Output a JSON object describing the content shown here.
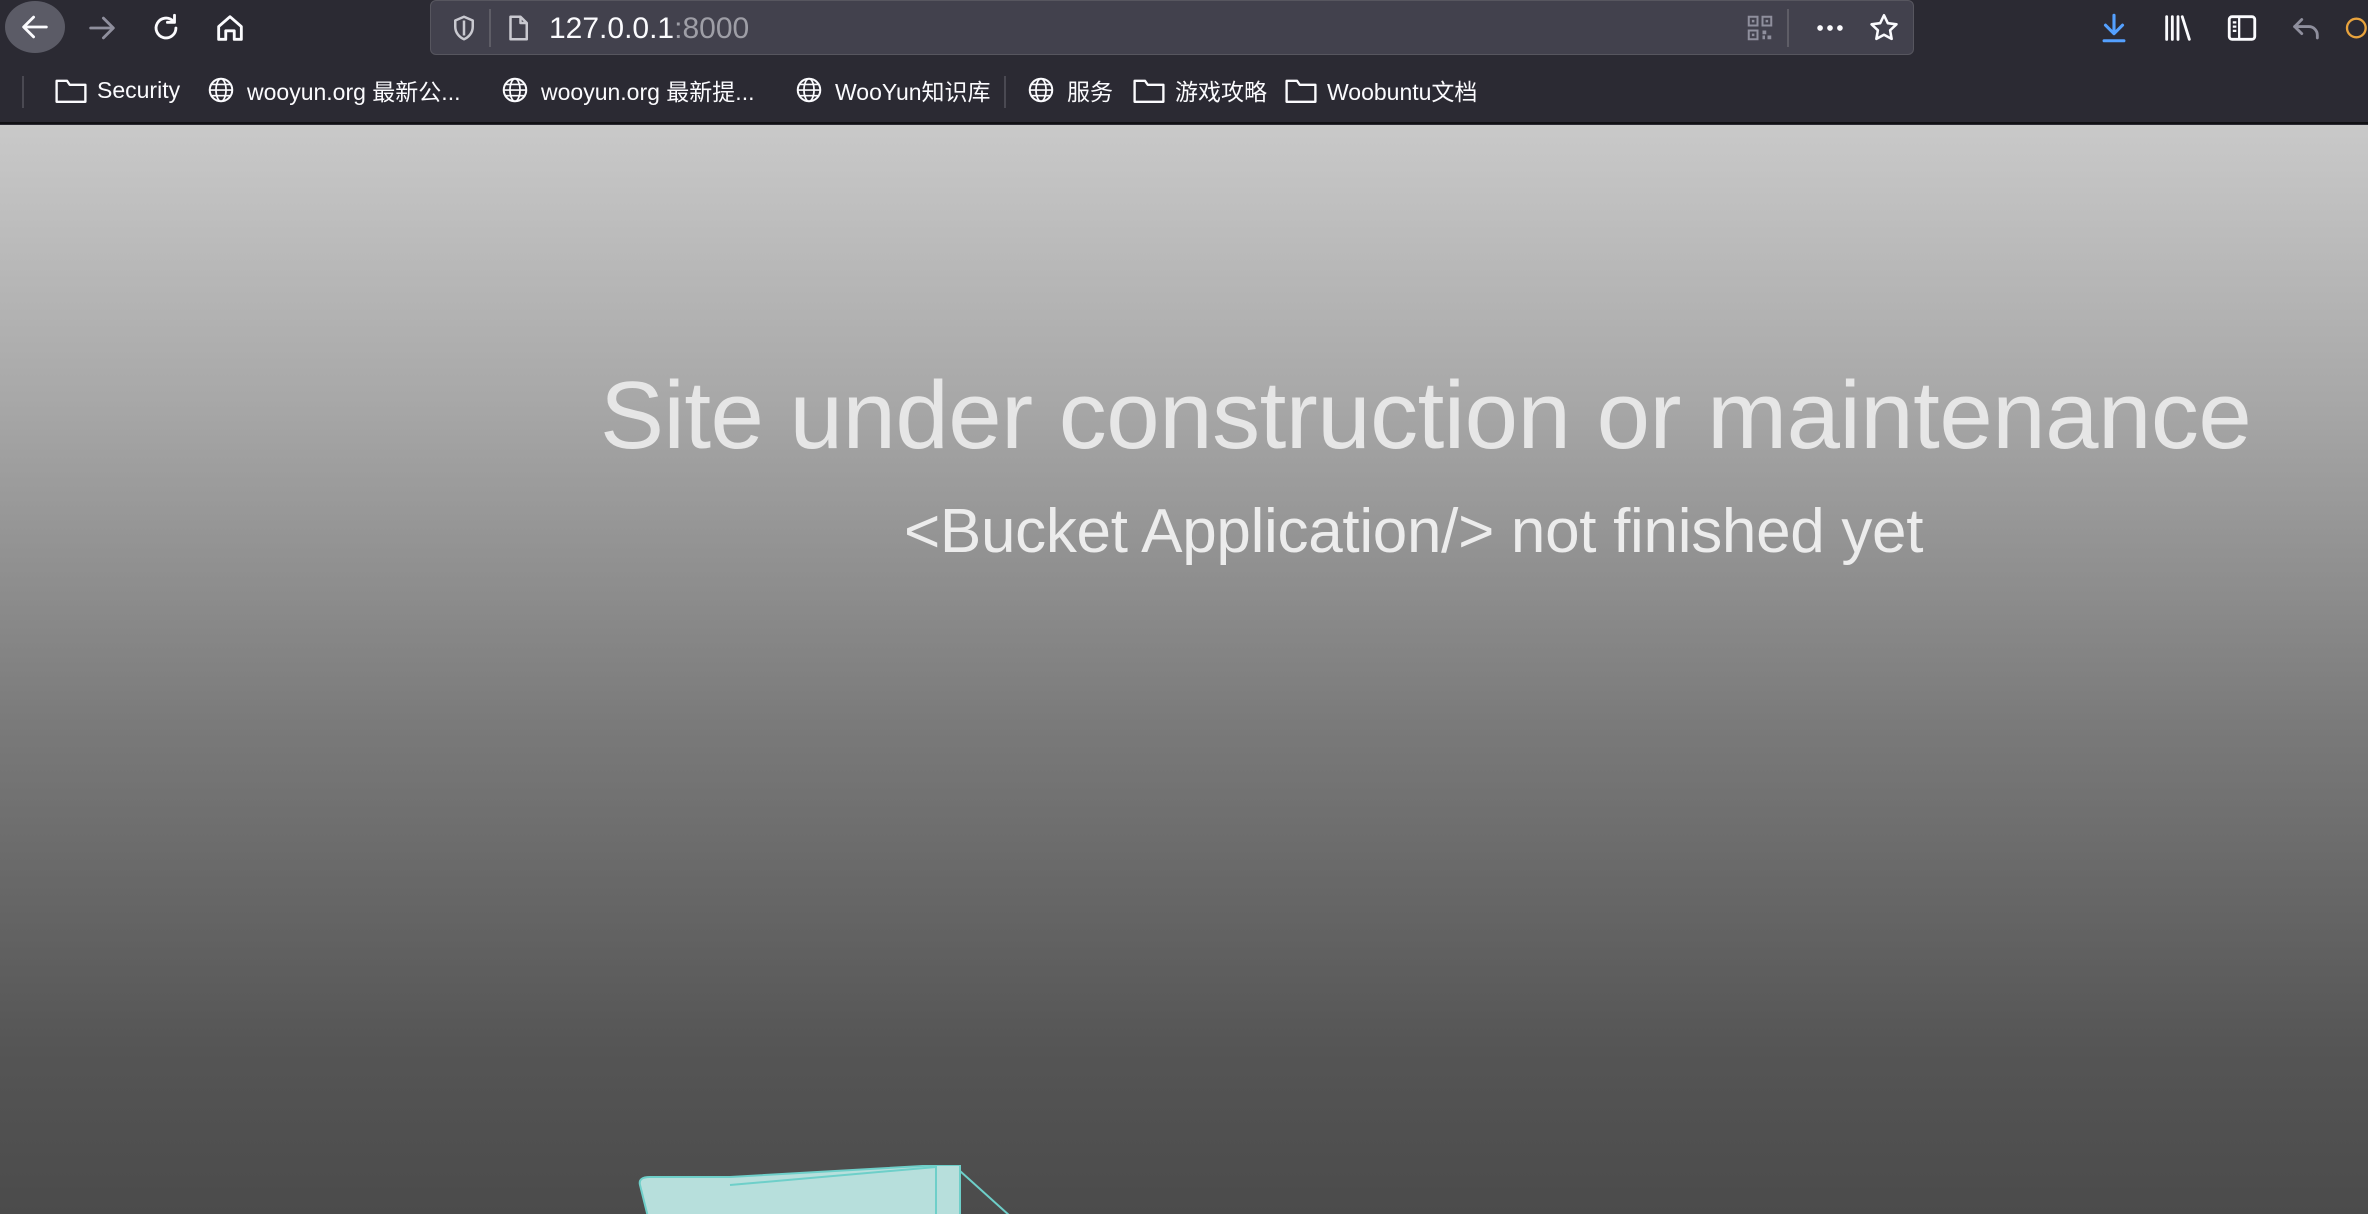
{
  "browser": {
    "url_host": "127.0.0.1",
    "url_port": ":8000",
    "icons": {
      "back": "back-arrow-icon",
      "forward": "forward-arrow-icon",
      "reload": "reload-icon",
      "home": "home-icon",
      "tracking": "shield-icon",
      "page": "page-icon",
      "qr": "qr-code-icon",
      "more": "more-actions-icon",
      "bookmark": "star-icon",
      "downloads": "download-icon",
      "library": "library-icon",
      "sidebar": "sidebar-icon",
      "undo": "undo-icon"
    },
    "colors": {
      "toolbar": "#2b2a33",
      "urlbar": "#42414d",
      "download_accent": "#54a0ff"
    }
  },
  "bookmarks": [
    {
      "label": "Security",
      "type": "folder"
    },
    {
      "label": "wooyun.org 最新公...",
      "type": "site"
    },
    {
      "label": "wooyun.org 最新提...",
      "type": "site"
    },
    {
      "label": "WooYun知识库",
      "type": "site"
    },
    {
      "label": "服务",
      "type": "site"
    },
    {
      "label": "游戏攻略",
      "type": "folder"
    },
    {
      "label": "Woobuntu文档",
      "type": "folder"
    }
  ],
  "page": {
    "headline": "Site under construction or maintenance",
    "subline": "<Bucket Application/> not finished yet"
  }
}
